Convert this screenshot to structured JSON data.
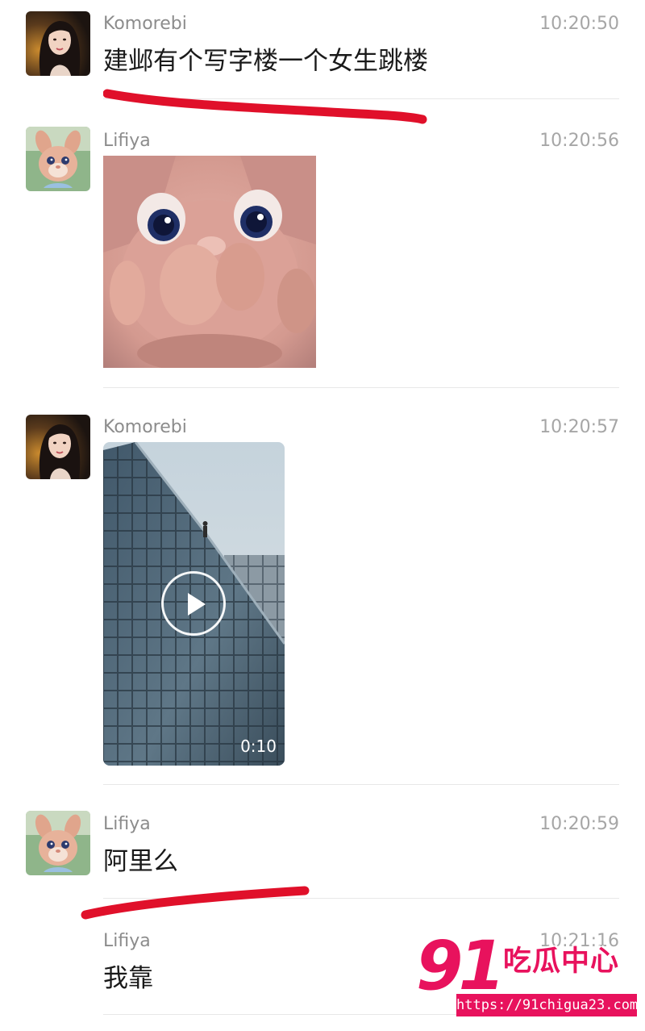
{
  "messages": [
    {
      "sender": "Komorebi",
      "time": "10:20:50",
      "text": "建邺有个写字楼一个女生跳楼"
    },
    {
      "sender": "Lifiya",
      "time": "10:20:56",
      "image": "pink-bunny-plush-closeup"
    },
    {
      "sender": "Komorebi",
      "time": "10:20:57",
      "video_duration": "0:10"
    },
    {
      "sender": "Lifiya",
      "time": "10:20:59",
      "text": "阿里么"
    },
    {
      "sender": "Lifiya",
      "time": "10:21:16",
      "text": "我靠"
    }
  ],
  "icons": {
    "play": "play-icon"
  },
  "watermark": {
    "number": "91",
    "brand": "吃瓜中心",
    "url": "https://91chigua23.com"
  },
  "colors": {
    "annotation_red": "#e0102a",
    "watermark_pink": "#e8125d",
    "name_gray": "#8c8c8c",
    "divider": "#e8e8e8"
  }
}
